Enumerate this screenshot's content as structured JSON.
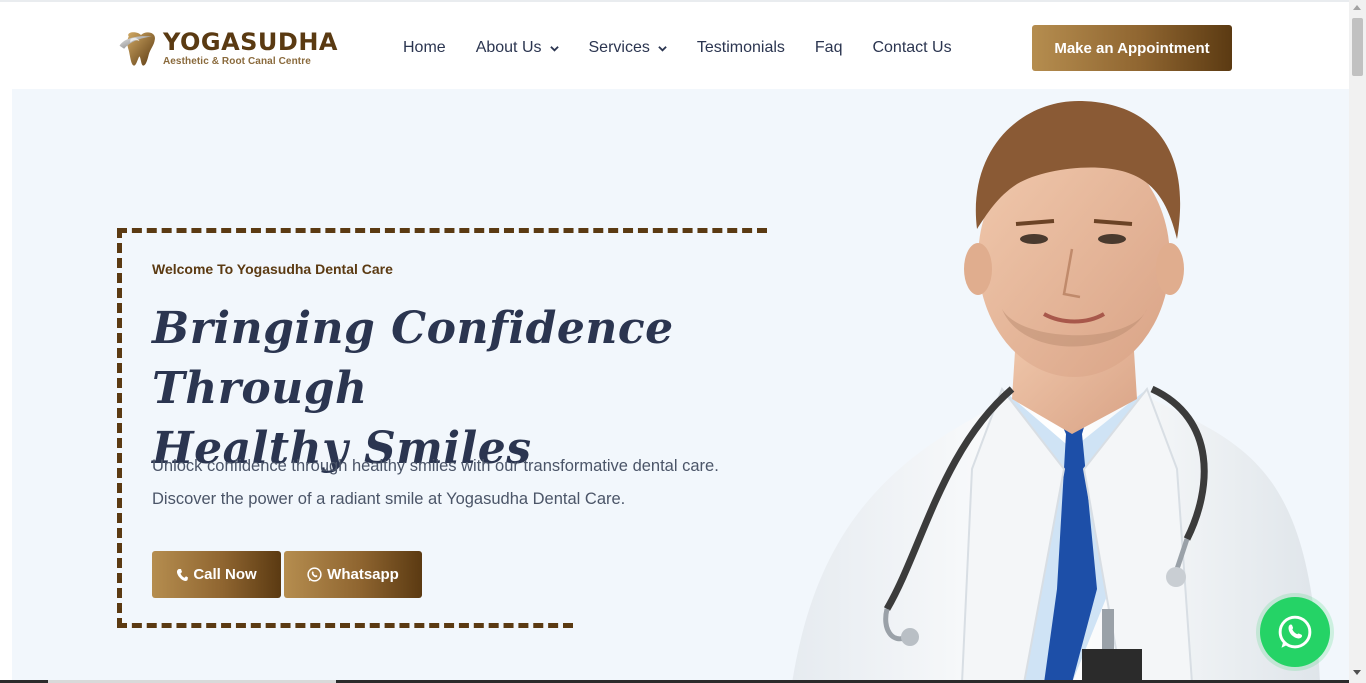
{
  "brand": {
    "name": "YOGASUDHA",
    "tagline": "Aesthetic & Root Canal Centre"
  },
  "nav": {
    "items": [
      {
        "label": "Home",
        "dropdown": false
      },
      {
        "label": "About Us",
        "dropdown": true
      },
      {
        "label": "Services",
        "dropdown": true
      },
      {
        "label": "Testimonials",
        "dropdown": false
      },
      {
        "label": "Faq",
        "dropdown": false
      },
      {
        "label": "Contact Us",
        "dropdown": false
      }
    ],
    "cta": "Make an Appointment"
  },
  "hero": {
    "welcome": "Welcome To Yogasudha Dental Care",
    "headline_line1": "Bringing Confidence Through",
    "headline_line2": "Healthy Smiles",
    "lead": "Unlock confidence through healthy smiles with our transformative dental care. Discover the power of a radiant smile at Yogasudha Dental Care.",
    "call_label": "Call Now",
    "whatsapp_label": "Whatsapp"
  },
  "colors": {
    "accent_gold": "#b58d4f",
    "accent_brown": "#5b3a12",
    "hero_bg": "#f2f7fc",
    "text_dark": "#2b3550",
    "whatsapp_green": "#25d366"
  },
  "icons": {
    "phone": "phone-icon",
    "whatsapp": "whatsapp-icon",
    "chevron": "chevron-down-icon",
    "logo": "tooth-logo-icon"
  }
}
